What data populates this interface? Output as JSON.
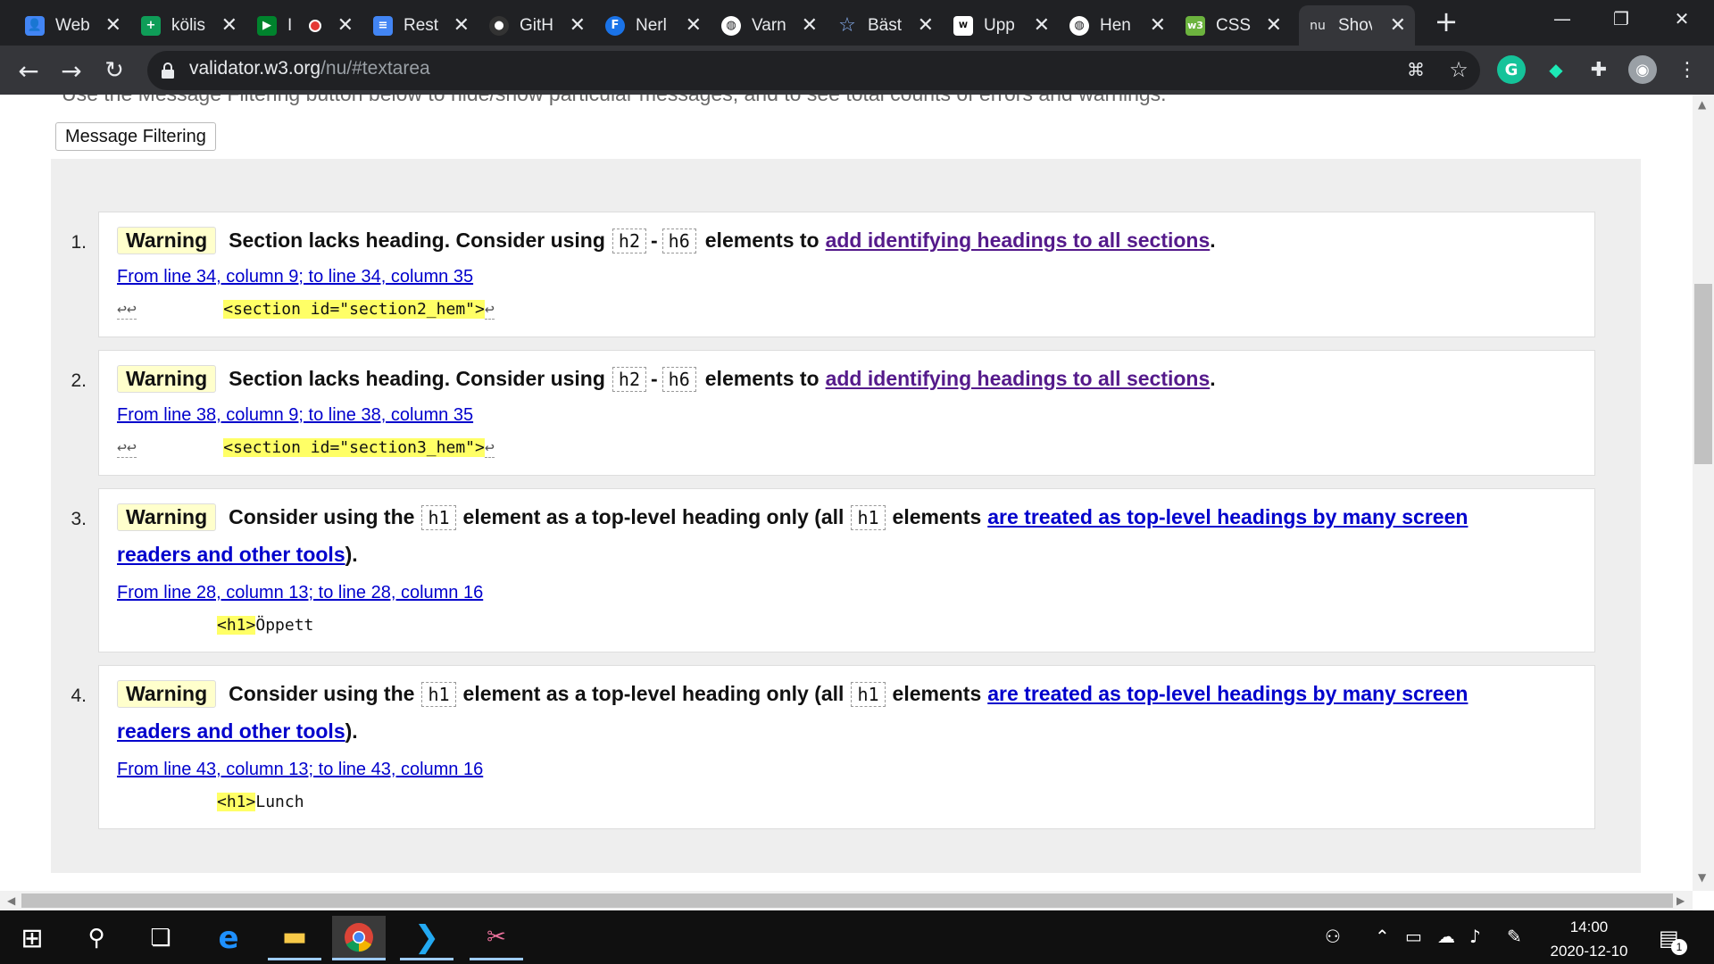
{
  "browser": {
    "tabs": [
      {
        "title": "Web",
        "favicon": "user-icon",
        "color": "#4285f4",
        "glyph": "👤"
      },
      {
        "title": "kölis",
        "favicon": "sheets-icon",
        "color": "#0f9d58",
        "glyph": "+"
      },
      {
        "title": "I",
        "favicon": "meet-icon",
        "color": "#00832d",
        "glyph": "▶"
      },
      {
        "title": "Rest",
        "favicon": "docs-icon",
        "color": "#4285f4",
        "glyph": "≡"
      },
      {
        "title": "GitH",
        "favicon": "github-icon",
        "color": "#333333",
        "glyph": "●"
      },
      {
        "title": "Nerl",
        "favicon": "f-icon",
        "color": "#1a73e8",
        "glyph": "F"
      },
      {
        "title": "Varn",
        "favicon": "globe-icon",
        "color": "#202124",
        "glyph": "◍"
      },
      {
        "title": "Bäst",
        "favicon": "star-icon",
        "color": "#202124",
        "glyph": "☆"
      },
      {
        "title": "Upp",
        "favicon": "webbo-icon",
        "color": "#ffffff",
        "glyph": "W"
      },
      {
        "title": "Hen",
        "favicon": "globe-icon",
        "color": "#202124",
        "glyph": "◍"
      },
      {
        "title": "CSS",
        "favicon": "w3-icon",
        "color": "#6cb33e",
        "glyph": "w3"
      },
      {
        "title": "Shov",
        "favicon": "nu-icon",
        "color": "#35363a",
        "glyph": "nu"
      }
    ],
    "url_host": "validator.w3.org",
    "url_path": "/nu/#textarea"
  },
  "page": {
    "intro": "Use the Message Filtering button below to hide/show particular messages, and to see total counts of errors and warnings.",
    "filter_button": "Message Filtering",
    "messages": [
      {
        "num": "1.",
        "badge": "Warning",
        "text_a": "Section lacks heading. Consider using",
        "code_a": "h2",
        "dash": "-",
        "code_b": "h6",
        "text_b": "elements to",
        "link": "add identifying headings to all sections",
        "end": ".",
        "location": "From line 34, column 9; to line 34, column 35",
        "extract_prefix": "↩↩",
        "extract_code": "<section id=\"section2_hem\">",
        "extract_suffix": "↩"
      },
      {
        "num": "2.",
        "badge": "Warning",
        "text_a": "Section lacks heading. Consider using",
        "code_a": "h2",
        "dash": "-",
        "code_b": "h6",
        "text_b": "elements to",
        "link": "add identifying headings to all sections",
        "end": ".",
        "location": "From line 38, column 9; to line 38, column 35",
        "extract_prefix": "↩↩",
        "extract_code": "<section id=\"section3_hem\">",
        "extract_suffix": "↩"
      },
      {
        "num": "3.",
        "badge": "Warning",
        "text_a": "Consider using the",
        "code_a": "h1",
        "text_b": "element as a top-level heading only (all",
        "code_b": "h1",
        "text_c": "elements",
        "link_a": "are treated as top-level headings by many screen",
        "link_b": "readers and other tools",
        "end": ").",
        "location": "From line 28, column 13; to line 28, column 16",
        "extract_code": "<h1>",
        "extract_text": "Öppett"
      },
      {
        "num": "4.",
        "badge": "Warning",
        "text_a": "Consider using the",
        "code_a": "h1",
        "text_b": "element as a top-level heading only (all",
        "code_b": "h1",
        "text_c": "elements",
        "link_a": "are treated as top-level headings by many screen",
        "link_b": "readers and other tools",
        "end": ").",
        "location": "From line 43, column 13; to line 43, column 16",
        "extract_code": "<h1>",
        "extract_text": "Lunch"
      }
    ]
  },
  "taskbar": {
    "time": "14:00",
    "date": "2020-12-10",
    "notification_count": "1"
  }
}
